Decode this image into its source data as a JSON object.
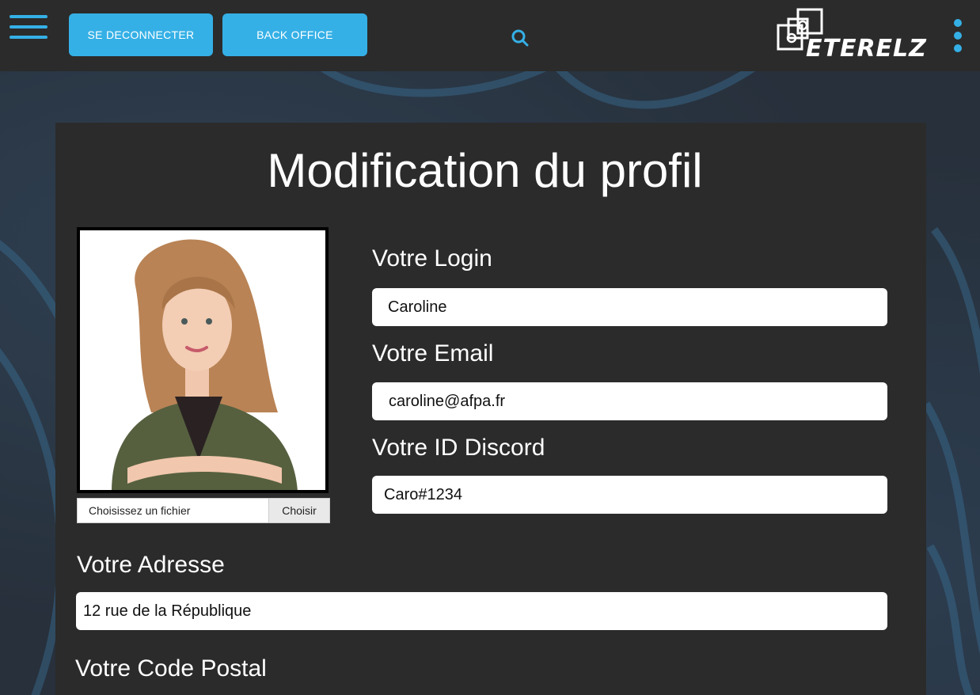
{
  "header": {
    "logout_label": "SE DECONNECTER",
    "backoffice_label": "BACK OFFICE",
    "logo_text": "ETERELZ",
    "accent_color": "#35b0e6"
  },
  "page": {
    "title": "Modification du profil"
  },
  "avatar": {
    "file_placeholder": "Choisissez un fichier",
    "choose_label": "Choisir"
  },
  "form": {
    "login_label": "Votre Login",
    "login_value": "Caroline",
    "email_label": "Votre Email",
    "email_value": "caroline@afpa.fr",
    "discord_label": "Votre ID Discord",
    "discord_value": "Caro#1234",
    "address_label": "Votre Adresse",
    "address_value": "12 rue de la République",
    "postal_label": "Votre Code Postal"
  }
}
